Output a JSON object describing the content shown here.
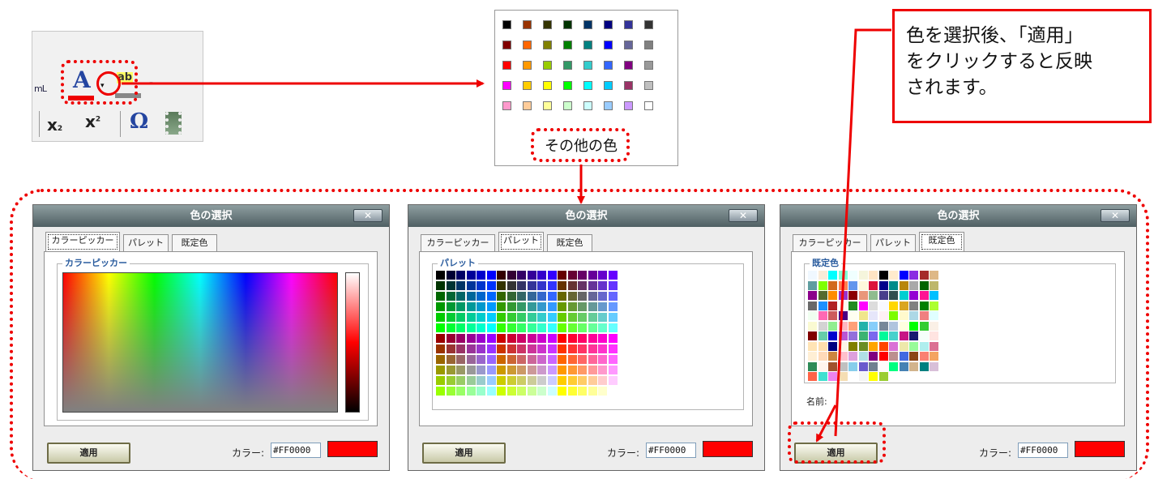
{
  "annotation": {
    "callout_lines": [
      "色を選択後、「適用」",
      "をクリックすると反映",
      "されます。"
    ],
    "highlight_color": "#e00000"
  },
  "toolbar": {
    "ml_label": "mL",
    "font_color_glyph": "A",
    "dropdown_glyph": "▾",
    "bg_color_glyph": "ab",
    "subscript_glyph": "x",
    "subscript_mark": "2",
    "superscript_glyph": "x",
    "superscript_mark": "2",
    "omega_glyph": "Ω",
    "icons": [
      "font-color-icon",
      "background-color-icon",
      "subscript-icon",
      "superscript-icon",
      "special-char-icon",
      "media-icon"
    ]
  },
  "palette": {
    "colors": [
      [
        "#000000",
        "#993300",
        "#333300",
        "#003300",
        "#003366",
        "#000080",
        "#333399",
        "#333333"
      ],
      [
        "#800000",
        "#ff6600",
        "#808000",
        "#008000",
        "#008080",
        "#0000ff",
        "#666699",
        "#808080"
      ],
      [
        "#ff0000",
        "#ff9900",
        "#99cc00",
        "#339966",
        "#33cccc",
        "#3366ff",
        "#800080",
        "#999999"
      ],
      [
        "#ff00ff",
        "#ffcc00",
        "#ffff00",
        "#00ff00",
        "#00ffff",
        "#00ccff",
        "#993366",
        "#c0c0c0"
      ],
      [
        "#ff99cc",
        "#ffcc99",
        "#ffff99",
        "#ccffcc",
        "#ccffff",
        "#99ccff",
        "#cc99ff",
        "#ffffff"
      ]
    ],
    "other_colors_label": "その他の色"
  },
  "dialogs": [
    {
      "title": "色の選択",
      "close_label": "✕",
      "tabs": [
        "カラーピッカー",
        "パレット",
        "既定色"
      ],
      "active_tab": 0,
      "legend": "カラーピッカー",
      "apply_label": "適用",
      "color_label": "カラー:",
      "color_value": "#FF0000",
      "preview_color": "#ff0000"
    },
    {
      "title": "色の選択",
      "close_label": "✕",
      "tabs": [
        "カラーピッカー",
        "パレット",
        "既定色"
      ],
      "active_tab": 1,
      "legend": "パレット",
      "apply_label": "適用",
      "color_label": "カラー:",
      "color_value": "#FF0000",
      "preview_color": "#ff0000"
    },
    {
      "title": "色の選択",
      "close_label": "✕",
      "tabs": [
        "カラーピッカー",
        "パレット",
        "既定色"
      ],
      "active_tab": 2,
      "legend": "既定色",
      "name_label": "名前:",
      "apply_label": "適用",
      "color_label": "カラー:",
      "color_value": "#FF0000",
      "preview_color": "#ff0000"
    }
  ]
}
